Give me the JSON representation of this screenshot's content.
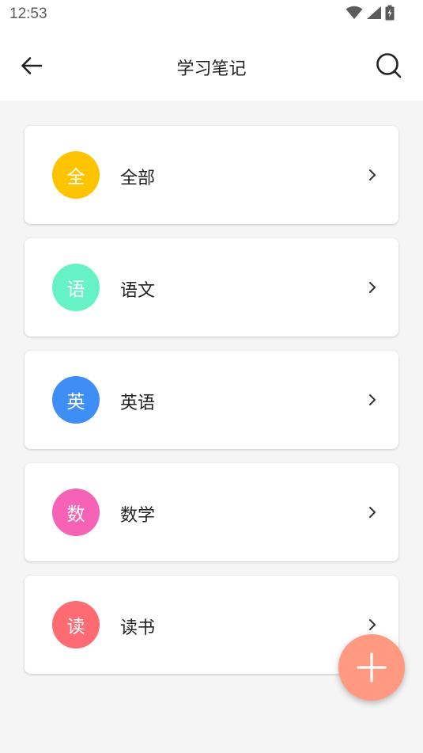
{
  "status_bar": {
    "time": "12:53",
    "icons": [
      "wifi-icon",
      "signal-icon",
      "battery-icon"
    ]
  },
  "app_bar": {
    "title": "学习笔记",
    "back_icon": "arrow-left-icon",
    "search_icon": "search-icon"
  },
  "categories": [
    {
      "icon_text": "全",
      "label": "全部",
      "color": "#FFC400"
    },
    {
      "icon_text": "语",
      "label": "语文",
      "color": "#66F2C4"
    },
    {
      "icon_text": "英",
      "label": "英语",
      "color": "#3F8EF5"
    },
    {
      "icon_text": "数",
      "label": "数学",
      "color": "#F562B6"
    },
    {
      "icon_text": "读",
      "label": "读书",
      "color": "#FF6B72"
    }
  ],
  "fab": {
    "icon": "plus-icon",
    "color": "#FF9A80"
  }
}
